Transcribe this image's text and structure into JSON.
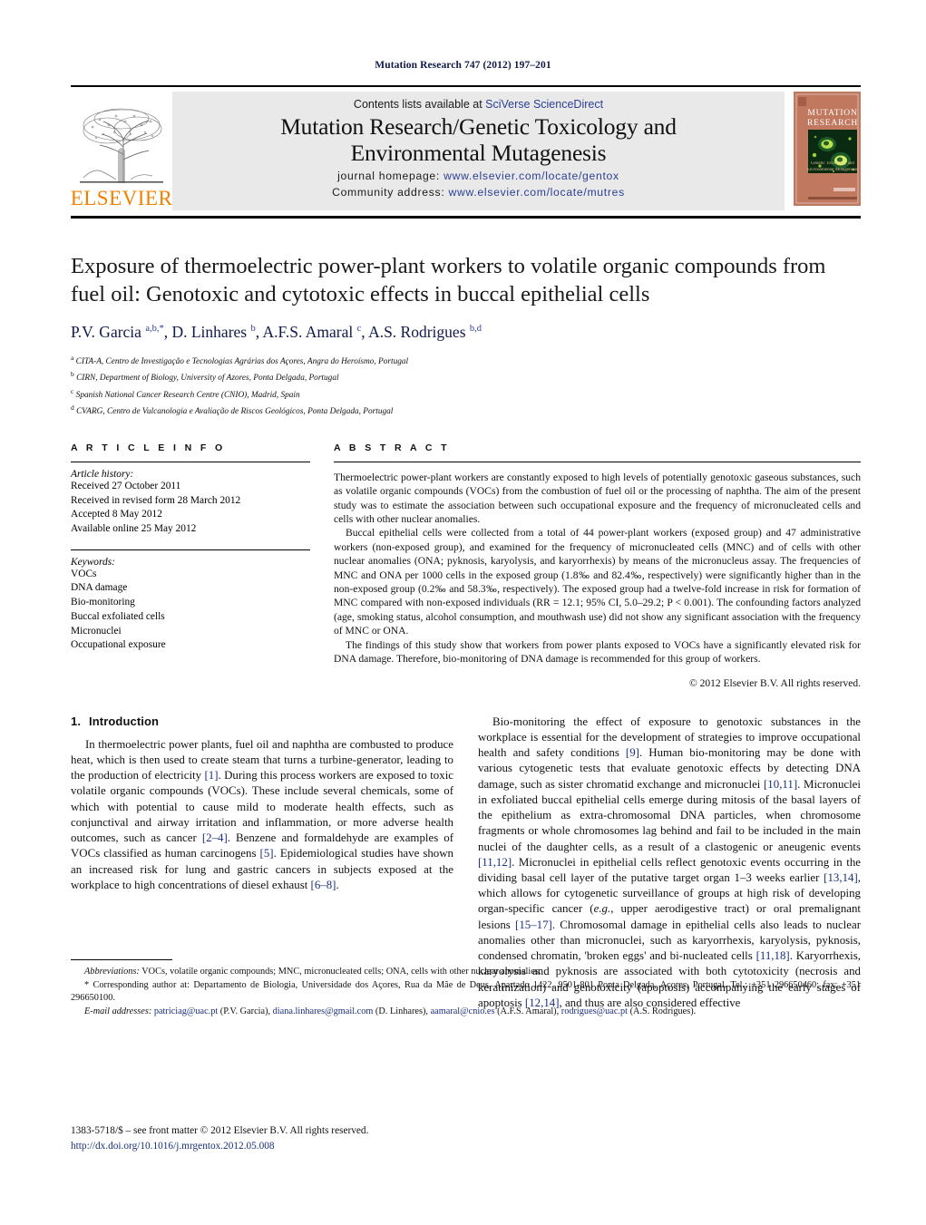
{
  "running_head": "Mutation Research 747 (2012) 197–201",
  "header": {
    "publisher_name": "ELSEVIER",
    "contents_prefix": "Contents lists available at ",
    "contents_link": "SciVerse ScienceDirect",
    "journal_title_line1": "Mutation Research/Genetic Toxicology and",
    "journal_title_line2": "Environmental Mutagenesis",
    "homepage_label": "journal homepage:",
    "homepage_url": "www.elsevier.com/locate/gentox",
    "community_label": "Community address:",
    "community_url": "www.elsevier.com/locate/mutres",
    "cover_title_line1": "MUTATION",
    "cover_title_line2": "RESEARCH",
    "cover_subtitle_line1": "Genetic Toxicology and",
    "cover_subtitle_line2": "Environmental Mutagenesis"
  },
  "article": {
    "title": "Exposure of thermoelectric power-plant workers to volatile organic compounds from fuel oil: Genotoxic and cytotoxic effects in buccal epithelial cells",
    "authors_html": "P.V. Garcia <sup>a,b,*</sup>, D. Linhares <sup>b</sup>, A.F.S. Amaral <sup>c</sup>, A.S. Rodrigues <sup>b,d</sup>",
    "affiliations": [
      {
        "marker": "a",
        "text": "CITA-A, Centro de Investigação e Tecnologias Agrárias dos Açores, Angra do Heroísmo, Portugal"
      },
      {
        "marker": "b",
        "text": "CIRN, Department of Biology, University of Azores, Ponta Delgada, Portugal"
      },
      {
        "marker": "c",
        "text": "Spanish National Cancer Research Centre (CNIO), Madrid, Spain"
      },
      {
        "marker": "d",
        "text": "CVARG, Centro de Vulcanologia e Avaliação de Riscos Geológicos, Ponta Delgada, Portugal"
      }
    ]
  },
  "article_info": {
    "heading": "A R T I C L E   I N F O",
    "history_label": "Article history:",
    "history": [
      "Received 27 October 2011",
      "Received in revised form 28 March 2012",
      "Accepted 8 May 2012",
      "Available online 25 May 2012"
    ],
    "keywords_label": "Keywords:",
    "keywords": [
      "VOCs",
      "DNA damage",
      "Bio-monitoring",
      "Buccal exfoliated cells",
      "Micronuclei",
      "Occupational exposure"
    ]
  },
  "abstract": {
    "heading": "A B S T R A C T",
    "paragraphs": [
      "Thermoelectric power-plant workers are constantly exposed to high levels of potentially genotoxic gaseous substances, such as volatile organic compounds (VOCs) from the combustion of fuel oil or the processing of naphtha. The aim of the present study was to estimate the association between such occupational exposure and the frequency of micronucleated cells and cells with other nuclear anomalies.",
      "Buccal epithelial cells were collected from a total of 44 power-plant workers (exposed group) and 47 administrative workers (non-exposed group), and examined for the frequency of micronucleated cells (MNC) and of cells with other nuclear anomalies (ONA; pyknosis, karyolysis, and karyorrhexis) by means of the micronucleus assay. The frequencies of MNC and ONA per 1000 cells in the exposed group (1.8‰ and 82.4‰, respectively) were significantly higher than in the non-exposed group (0.2‰ and 58.3‰, respectively). The exposed group had a twelve-fold increase in risk for formation of MNC compared with non-exposed individuals (RR = 12.1; 95% CI, 5.0–29.2; P < 0.001). The confounding factors analyzed (age, smoking status, alcohol consumption, and mouthwash use) did not show any significant association with the frequency of MNC or ONA.",
      "The findings of this study show that workers from power plants exposed to VOCs have a significantly elevated risk for DNA damage. Therefore, bio-monitoring of DNA damage is recommended for this group of workers."
    ],
    "copyright": "© 2012 Elsevier B.V. All rights reserved."
  },
  "body": {
    "section_number": "1.",
    "section_title": "Introduction",
    "left_paragraph_html": "In thermoelectric power plants, fuel oil and naphtha are combusted to produce heat, which is then used to create steam that turns a turbine-generator, leading to the production of electricity <span class=\"ref\">[1]</span>. During this process workers are exposed to toxic volatile organic compounds (VOCs). These include several chemicals, some of which with potential to cause mild to moderate health effects, such as conjunctival and airway irritation and inflammation, or more adverse health outcomes, such as cancer <span class=\"ref\">[2–4]</span>. Benzene and formaldehyde are examples of VOCs classified as human carcinogens <span class=\"ref\">[5]</span>. Epidemiological studies have shown an increased risk for lung and gastric cancers in subjects exposed at the workplace to high concentrations of diesel exhaust <span class=\"ref\">[6–8]</span>.",
    "right_paragraph_html": "Bio-monitoring the effect of exposure to genotoxic substances in the workplace is essential for the development of strategies to improve occupational health and safety conditions <span class=\"ref\">[9]</span>. Human bio-monitoring may be done with various cytogenetic tests that evaluate genotoxic effects by detecting DNA damage, such as sister chromatid exchange and micronuclei <span class=\"ref\">[10,11]</span>. Micronuclei in exfoliated buccal epithelial cells emerge during mitosis of the basal layers of the epithelium as extra-chromosomal DNA particles, when chromosome fragments or whole chromosomes lag behind and fail to be included in the main nuclei of the daughter cells, as a result of a clastogenic or aneugenic events <span class=\"ref\">[11,12]</span>. Micronuclei in epithelial cells reflect genotoxic events occurring in the dividing basal cell layer of the putative target organ 1–3 weeks earlier <span class=\"ref\">[13,14]</span>, which allows for cytogenetic surveillance of groups at high risk of developing organ-specific cancer (<i>e.g.</i>, upper aerodigestive tract) or oral premalignant lesions <span class=\"ref\">[15–17]</span>. Chromosomal damage in epithelial cells also leads to nuclear anomalies other than micronuclei, such as karyorrhexis, karyolysis, pyknosis, condensed chromatin, 'broken eggs' and bi-nucleated cells <span class=\"ref\">[11,18]</span>. Karyorrhexis, karyolysis and pyknosis are associated with both cytotoxicity (necrosis and keratinization) and genotoxicity (apoptosis) accompanying the early stages of apoptosis <span class=\"ref\">[12,14]</span>, and thus are also considered effective"
  },
  "footnotes": {
    "abbreviations_html": "<i>Abbreviations:</i>  VOCs, volatile organic compounds; MNC, micronucleated cells; ONA, cells with other nuclear anomalies.",
    "corresponding_html": "* Corresponding author at: Departamento de Biologia, Universidade dos Açores, Rua da Mãe de Deus, Apartado 1422, 9501-801 Ponta Delgada, Açores, Portugal. Tel.: +351 296650460; fax: +351 296650100.",
    "emails_html": "<i>E-mail addresses:</i> <span class=\"mail\">patriciag@uac.pt</span> (P.V. Garcia), <span class=\"mail\">diana.linhares@gmail.com</span> (D. Linhares), <span class=\"mail\">aamaral@cnio.es</span> (A.F.S. Amaral), <span class=\"mail\">rodrigues@uac.pt</span> (A.S. Rodrigues)."
  },
  "page_footer": {
    "issn_line": "1383-5718/$ – see front matter © 2012 Elsevier B.V. All rights reserved.",
    "doi": "http://dx.doi.org/10.1016/j.mrgentox.2012.05.008"
  },
  "colors": {
    "link": "#2a3f95",
    "reference": "#1b2f7a",
    "brand_orange": "#f08000",
    "header_band": "#e9e9e9",
    "cover_bg": "#c0785f"
  }
}
